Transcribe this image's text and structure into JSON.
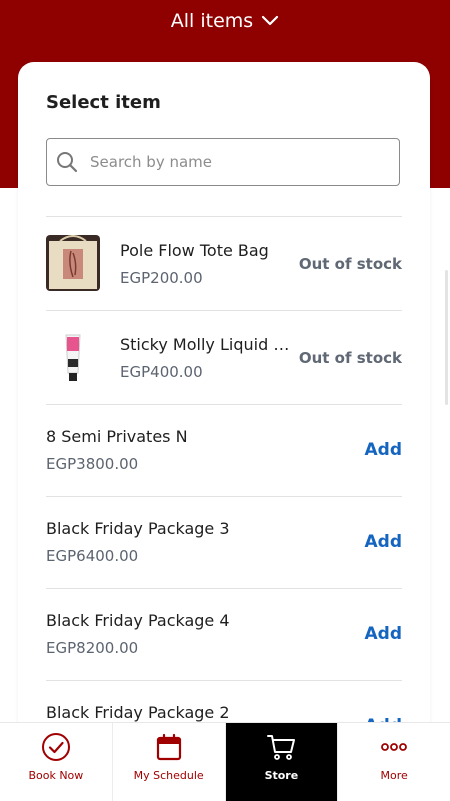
{
  "header": {
    "title": "All items"
  },
  "card": {
    "title": "Select item",
    "search": {
      "placeholder": "Search by name",
      "value": ""
    }
  },
  "items": [
    {
      "name": "Pole Flow Tote Bag",
      "price": "EGP200.00",
      "status": "Out of stock",
      "thumbnail": "tote-bag-image"
    },
    {
      "name": "Sticky Molly Liquid Grip",
      "price": "EGP400.00",
      "status": "Out of stock",
      "thumbnail": "grip-tube-image"
    },
    {
      "name": "8 Semi Privates N",
      "price": "EGP3800.00",
      "action": "Add"
    },
    {
      "name": "Black Friday Package 3",
      "price": "EGP6400.00",
      "action": "Add"
    },
    {
      "name": "Black Friday Package 4",
      "price": "EGP8200.00",
      "action": "Add"
    },
    {
      "name": "Black Friday Package 2",
      "price": "",
      "action": "Add"
    }
  ],
  "nav": {
    "items": [
      {
        "label": "Book Now",
        "icon": "check-circle-icon"
      },
      {
        "label": "My Schedule",
        "icon": "calendar-icon"
      },
      {
        "label": "Store",
        "icon": "cart-icon",
        "active": true
      },
      {
        "label": "More",
        "icon": "more-dots-icon"
      }
    ]
  },
  "colors": {
    "brand": "#8f0000",
    "accent": "#1565c0",
    "nav_active_bg": "#000000"
  }
}
